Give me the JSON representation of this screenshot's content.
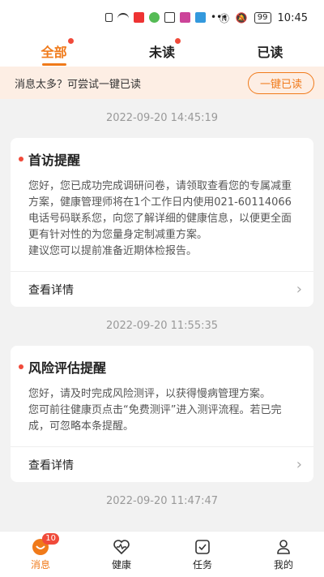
{
  "status_bar": {
    "time": "10:45",
    "battery": "99"
  },
  "tabs": [
    {
      "label": "全部"
    },
    {
      "label": "未读"
    },
    {
      "label": "已读"
    }
  ],
  "banner": {
    "text": "消息太多？可尝试一键已读",
    "button": "一键已读"
  },
  "messages": [
    {
      "timestamp": "2022-09-20 14:45:19",
      "title": "首访提醒",
      "body": "您好，您已成功完成调研问卷，请领取查看您的专属减重方案，健康管理师将在1个工作日内使用021-60114066电话号码联系您，向您了解详细的健康信息，以便更全面更有针对性的为您量身定制减重方案。\n建议您可以提前准备近期体检报告。",
      "footer": "查看详情"
    },
    {
      "timestamp": "2022-09-20 11:55:35",
      "title": "风险评估提醒",
      "body": "您好，请及时完成风险测评，以获得慢病管理方案。\n您可前往健康页点击“免费测评”进入测评流程。若已完成，可忽略本条提醒。",
      "footer": "查看详情"
    },
    {
      "timestamp": "2022-09-20 11:47:47"
    }
  ],
  "bottom_nav": [
    {
      "label": "消息",
      "badge": "10",
      "icon": "message-icon"
    },
    {
      "label": "健康",
      "icon": "heart-pulse-icon"
    },
    {
      "label": "任务",
      "icon": "task-check-icon"
    },
    {
      "label": "我的",
      "icon": "profile-icon"
    }
  ],
  "colors": {
    "accent": "#f07a1a",
    "dot": "#f04a3a",
    "banner_bg": "#fdeee4"
  }
}
